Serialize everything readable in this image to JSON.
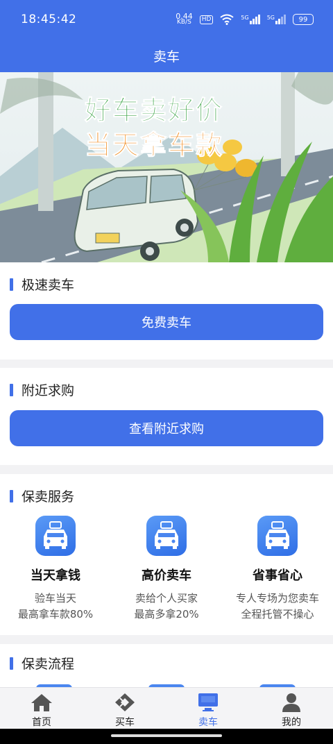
{
  "status": {
    "time": "18:45:42",
    "net_speed_value": "0.44",
    "net_speed_unit": "KB/S",
    "hd_badge": "HD",
    "sig1_label": "5G",
    "sig2_label": "5G",
    "battery": "99"
  },
  "header": {
    "title": "卖车"
  },
  "banner": {
    "line1": "好车卖好价",
    "line2": "当天拿车款"
  },
  "fast_sell": {
    "title": "极速卖车",
    "button": "免费卖车"
  },
  "nearby": {
    "title": "附近求购",
    "button": "查看附近求购"
  },
  "service": {
    "title": "保卖服务",
    "items": [
      {
        "name": "当天拿钱",
        "desc1": "验车当天",
        "desc2": "最高拿车款80%",
        "icon": "car-icon"
      },
      {
        "name": "高价卖车",
        "desc1": "卖给个人买家",
        "desc2": "最高多拿20%",
        "icon": "car-icon"
      },
      {
        "name": "省事省心",
        "desc1": "专人专场为您卖车",
        "desc2": "全程托管不操心",
        "icon": "car-icon"
      }
    ]
  },
  "process": {
    "title": "保卖流程"
  },
  "tabs": [
    {
      "label": "首页",
      "icon": "home-icon",
      "active": false
    },
    {
      "label": "买车",
      "icon": "diamond-icon",
      "active": false
    },
    {
      "label": "卖车",
      "icon": "monitor-icon",
      "active": true
    },
    {
      "label": "我的",
      "icon": "user-icon",
      "active": false
    }
  ],
  "colors": {
    "primary": "#4170e8",
    "banner_green": "#2f9e3b",
    "banner_orange": "#f08a1c"
  }
}
